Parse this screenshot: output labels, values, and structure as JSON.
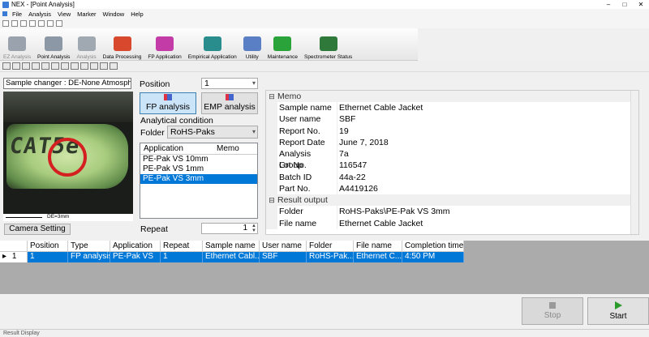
{
  "window": {
    "title": "NEX - [Point Analysis]",
    "min": "–",
    "max": "□",
    "close": "✕"
  },
  "menu": [
    "File",
    "Analysis",
    "View",
    "Marker",
    "Window",
    "Help"
  ],
  "ribbon": [
    {
      "label": "EZ Analysis",
      "color": "#9aa3ad",
      "dim": true
    },
    {
      "label": "Point Analysis",
      "color": "#8d98a6",
      "dim": false
    },
    {
      "label": "Analysis",
      "color": "#a0a8b2",
      "dim": true
    },
    {
      "label": "Data Processing",
      "color": "#d8482d",
      "dim": false
    },
    {
      "label": "FP Application",
      "color": "#c23ba6",
      "dim": false
    },
    {
      "label": "Empirical Application",
      "color": "#2a8d8d",
      "dim": false
    },
    {
      "label": "Utility",
      "color": "#5b7fc4",
      "dim": false
    },
    {
      "label": "Maintenance",
      "color": "#2aa33a",
      "dim": false
    },
    {
      "label": "Spectrometer Status",
      "color": "#2f7a3a",
      "dim": false
    }
  ],
  "sample_changer": "Sample changer : DE-None  Atmosph",
  "camera": {
    "text": "CAT5e",
    "scale": "DE=3mm"
  },
  "camera_setting": "Camera Setting",
  "position": {
    "label": "Position",
    "value": "1"
  },
  "fp_analysis": "FP analysis",
  "emp_analysis": "EMP analysis",
  "analytical_condition": "Analytical condition",
  "folder": {
    "label": "Folder",
    "value": "RoHS-Paks"
  },
  "app_list": {
    "headers": [
      "Application",
      "Memo"
    ],
    "items": [
      "PE-Pak VS 10mm",
      "PE-Pak VS 1mm",
      "PE-Pak VS 3mm"
    ],
    "selected": 2
  },
  "repeat": {
    "label": "Repeat",
    "value": "1"
  },
  "props": {
    "memo_cat": "Memo",
    "memo": [
      [
        "Sample name",
        "Ethernet Cable Jacket"
      ],
      [
        "User name",
        "SBF"
      ],
      [
        "Report No.",
        "19"
      ],
      [
        "Report Date",
        "June 7, 2018"
      ],
      [
        "Analysis Group",
        "7a"
      ],
      [
        "Lot No.",
        "116547"
      ],
      [
        "Batch ID",
        "44a-22"
      ],
      [
        "Part No.",
        "A4419126"
      ]
    ],
    "result_cat": "Result output",
    "result": [
      [
        "Folder",
        "RoHS-Paks\\PE-Pak VS 3mm"
      ],
      [
        "File name",
        "Ethernet Cable Jacket"
      ]
    ]
  },
  "grid": {
    "headers": [
      "",
      "Position",
      "Type",
      "Application",
      "Repeat",
      "Sample name",
      "User name",
      "Folder",
      "File name",
      "Completion time"
    ],
    "row": [
      "1",
      "FP analysis",
      "PE-Pak VS",
      "1",
      "Ethernet Cabl...",
      "SBF",
      "RoHS-Pak...",
      "Ethernet C...",
      "4:50 PM"
    ],
    "row_head": "1"
  },
  "stop": "Stop",
  "start": "Start",
  "status": "Result Display"
}
